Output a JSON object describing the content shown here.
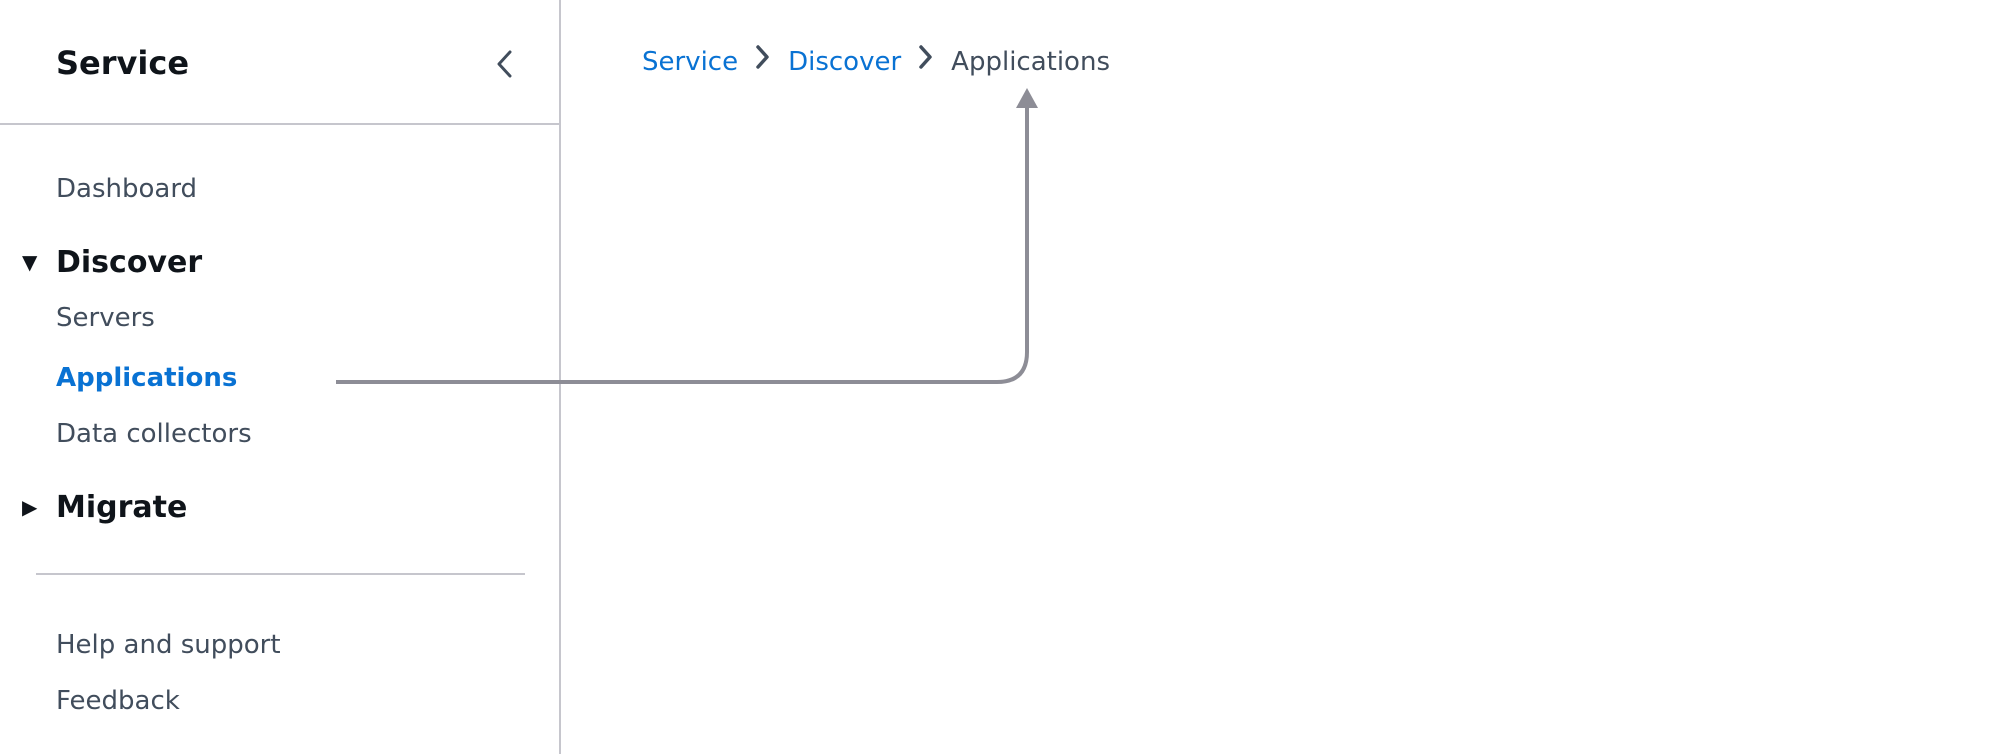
{
  "sidebar": {
    "title": "Service",
    "collapse_icon": "chevron-left-icon",
    "items": [
      {
        "label": "Dashboard",
        "type": "link"
      },
      {
        "label": "Discover",
        "type": "section",
        "expanded": true,
        "children": [
          {
            "label": "Servers",
            "active": false
          },
          {
            "label": "Applications",
            "active": true
          },
          {
            "label": "Data collectors",
            "active": false
          }
        ]
      },
      {
        "label": "Migrate",
        "type": "section",
        "expanded": false
      }
    ],
    "footer_items": [
      {
        "label": "Help and support"
      },
      {
        "label": "Feedback"
      }
    ]
  },
  "breadcrumb": {
    "items": [
      {
        "label": "Service",
        "link": true
      },
      {
        "label": "Discover",
        "link": true
      },
      {
        "label": "Applications",
        "link": false
      }
    ],
    "separator_icon": "chevron-right-icon"
  },
  "annotation": {
    "type": "arrow",
    "from": "sidebar Applications link",
    "to": "breadcrumb Applications",
    "color": "#8d8d96"
  },
  "colors": {
    "link": "#0972d3",
    "text": "#414d5c",
    "heading": "#0f141a",
    "border": "#c6c6cd"
  }
}
